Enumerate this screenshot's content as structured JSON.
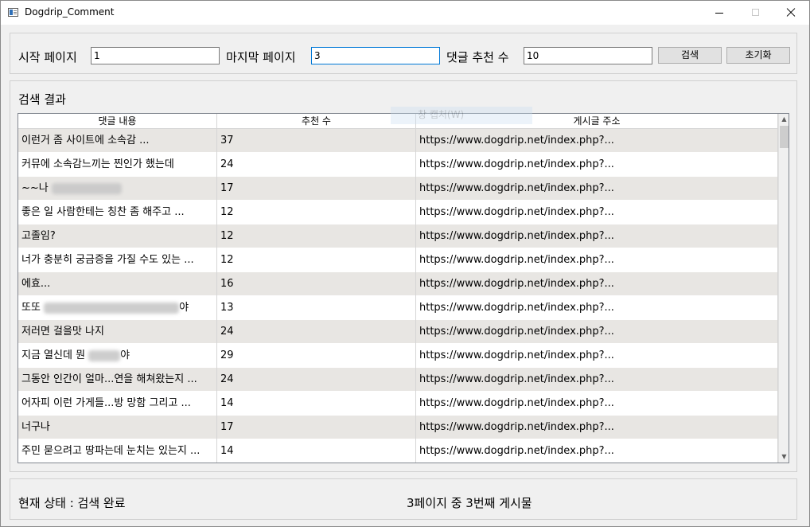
{
  "window": {
    "title": "Dogdrip_Comment"
  },
  "search": {
    "start_label": "시작 페이지",
    "start_value": "1",
    "end_label": "마지막 페이지",
    "end_value": "3",
    "recommend_label": "댓글 추천 수",
    "recommend_value": "10",
    "search_button": "검색",
    "reset_button": "초기화"
  },
  "results": {
    "label": "검색 결과",
    "ghost_tooltip": "창 캡처(W)",
    "columns": [
      "댓글 내용",
      "추천 수",
      "게시글 주소"
    ],
    "rows": [
      {
        "comment": "이런거 좀 사이트에 소속감 ...",
        "likes": "37",
        "url": "https://www.dogdrip.net/index.php?..."
      },
      {
        "comment": "커뮤에 소속감느끼는 찐인가 했는데",
        "likes": "24",
        "url": "https://www.dogdrip.net/index.php?..."
      },
      {
        "comment": "~~나",
        "likes": "17",
        "url": "https://www.dogdrip.net/index.php?..."
      },
      {
        "comment": "좋은 일 사람한테는 칭찬 좀 해주고 ...",
        "likes": "12",
        "url": "https://www.dogdrip.net/index.php?..."
      },
      {
        "comment": "고졸임?",
        "likes": "12",
        "url": "https://www.dogdrip.net/index.php?..."
      },
      {
        "comment": "너가 충분히 궁금증을 가질 수도 있는 ...",
        "likes": "12",
        "url": "https://www.dogdrip.net/index.php?..."
      },
      {
        "comment": "에효...",
        "likes": "16",
        "url": "https://www.dogdrip.net/index.php?..."
      },
      {
        "comment": "또또",
        "comment_suffix": "야",
        "likes": "13",
        "url": "https://www.dogdrip.net/index.php?..."
      },
      {
        "comment": "저러면 걸을맛 나지",
        "likes": "24",
        "url": "https://www.dogdrip.net/index.php?..."
      },
      {
        "comment": "지금 열신데 뭔",
        "comment_suffix": "야",
        "likes": "29",
        "url": "https://www.dogdrip.net/index.php?..."
      },
      {
        "comment": "그동안 인간이 얼마...연을 해쳐왔는지 ...",
        "likes": "24",
        "url": "https://www.dogdrip.net/index.php?..."
      },
      {
        "comment": "어자피 이런 가게들...방 망함 그리고 ...",
        "likes": "14",
        "url": "https://www.dogdrip.net/index.php?..."
      },
      {
        "comment": "너구나",
        "likes": "17",
        "url": "https://www.dogdrip.net/index.php?..."
      },
      {
        "comment": "주민 묻으려고 땅파는데 눈치는 있는지 ...",
        "likes": "14",
        "url": "https://www.dogdrip.net/index.php?..."
      }
    ]
  },
  "status": {
    "state_text": "현재 상태 : 검색 완료",
    "progress_text": "3페이지 중 3번째 게시물"
  }
}
